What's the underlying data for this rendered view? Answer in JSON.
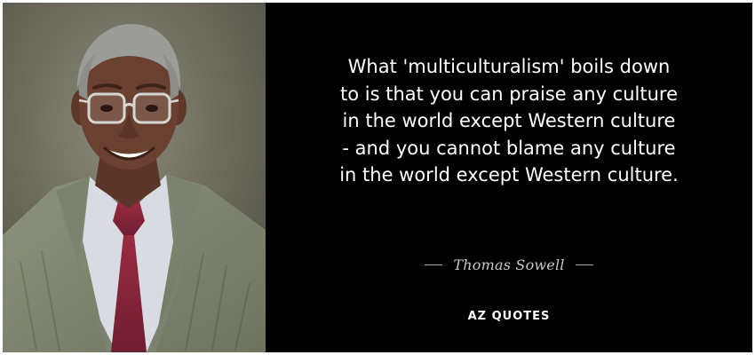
{
  "quote": {
    "lines": [
      "What 'multiculturalism' boils down",
      "to is that you can praise any culture",
      "in the world except Western culture",
      "- and you cannot blame any culture",
      "in the world except Western culture."
    ]
  },
  "author": {
    "name": "Thomas Sowell"
  },
  "brand": {
    "name": "AZ QUOTES"
  },
  "colors": {
    "background": "#000000",
    "text": "#ffffff",
    "author": "#c9c9c9"
  }
}
